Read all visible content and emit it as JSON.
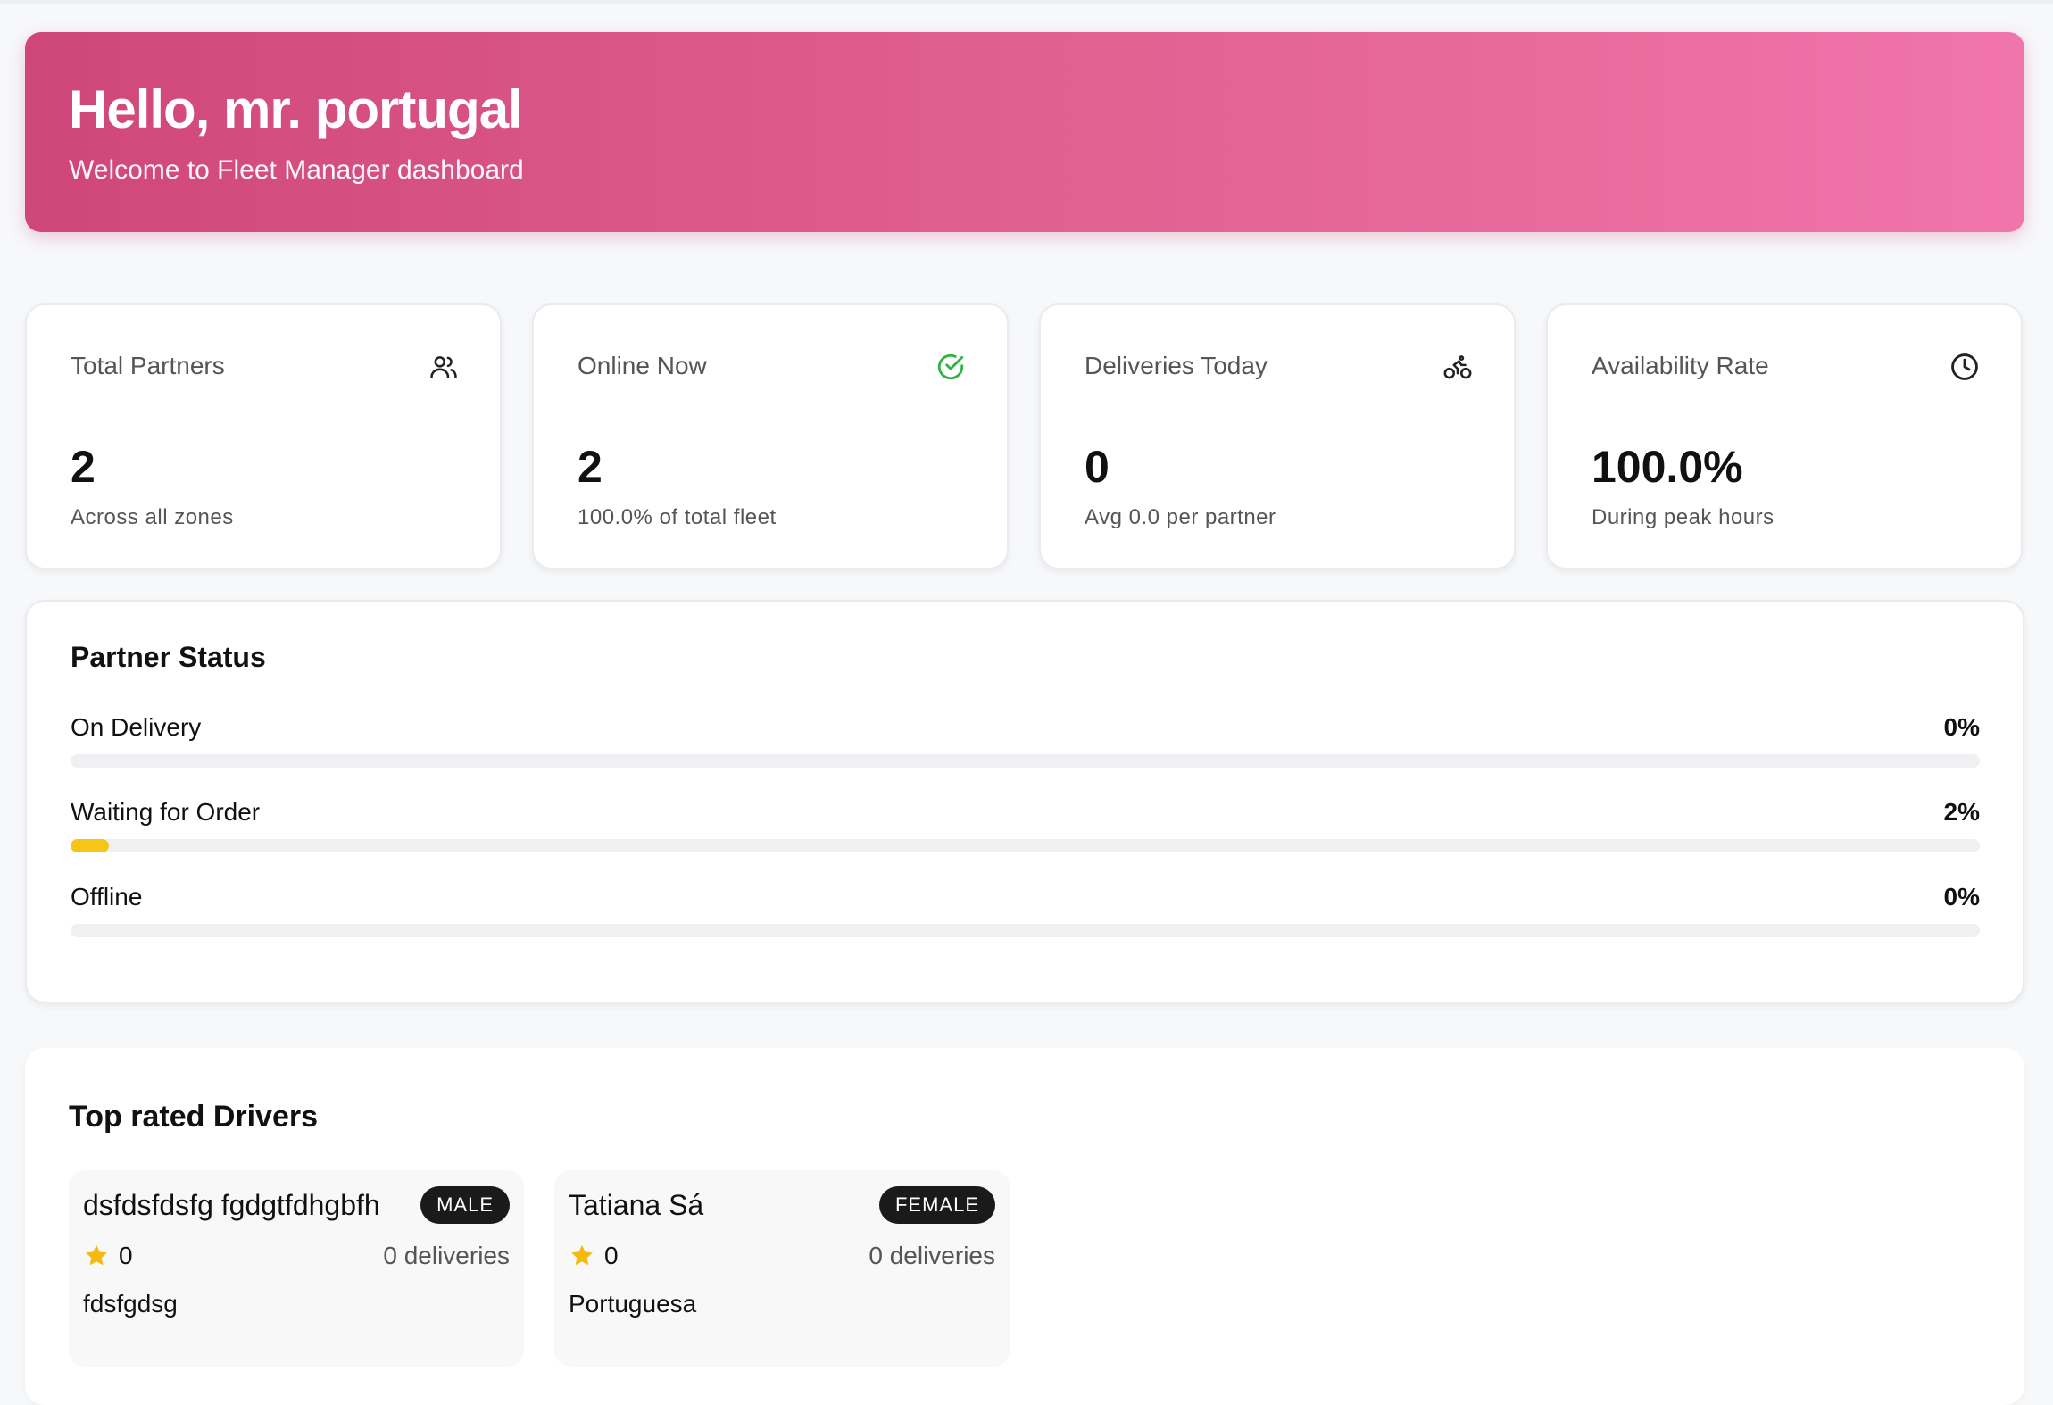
{
  "header": {
    "greeting": "Hello, mr. portugal",
    "subtitle": "Welcome to Fleet Manager dashboard"
  },
  "stats": [
    {
      "title": "Total Partners",
      "value": "2",
      "sub": "Across all zones",
      "icon": "users-icon"
    },
    {
      "title": "Online Now",
      "value": "2",
      "sub": "100.0% of total fleet",
      "icon": "check-circle-icon"
    },
    {
      "title": "Deliveries Today",
      "value": "0",
      "sub": "Avg 0.0 per partner",
      "icon": "bike-icon"
    },
    {
      "title": "Availability Rate",
      "value": "100.0%",
      "sub": "During peak hours",
      "icon": "clock-icon"
    }
  ],
  "partner_status": {
    "title": "Partner Status",
    "rows": [
      {
        "label": "On Delivery",
        "pct_label": "0%",
        "pct": 0
      },
      {
        "label": "Waiting for Order",
        "pct_label": "2%",
        "pct": 2
      },
      {
        "label": "Offline",
        "pct_label": "0%",
        "pct": 0
      }
    ]
  },
  "drivers": {
    "title": "Top rated Drivers",
    "items": [
      {
        "name": "dsfdsfdsfg fgdgtfdhgbfh",
        "gender": "MALE",
        "rating": "0",
        "deliveries": "0 deliveries",
        "nationality": "fdsfgdsg"
      },
      {
        "name": "Tatiana Sá",
        "gender": "FEMALE",
        "rating": "0",
        "deliveries": "0 deliveries",
        "nationality": "Portuguesa"
      }
    ]
  },
  "colors": {
    "accent_start": "#cf4778",
    "accent_end": "#f075ab",
    "online_green": "#2fb344",
    "bar_fill": "#f5c518",
    "star": "#f5b90f"
  }
}
